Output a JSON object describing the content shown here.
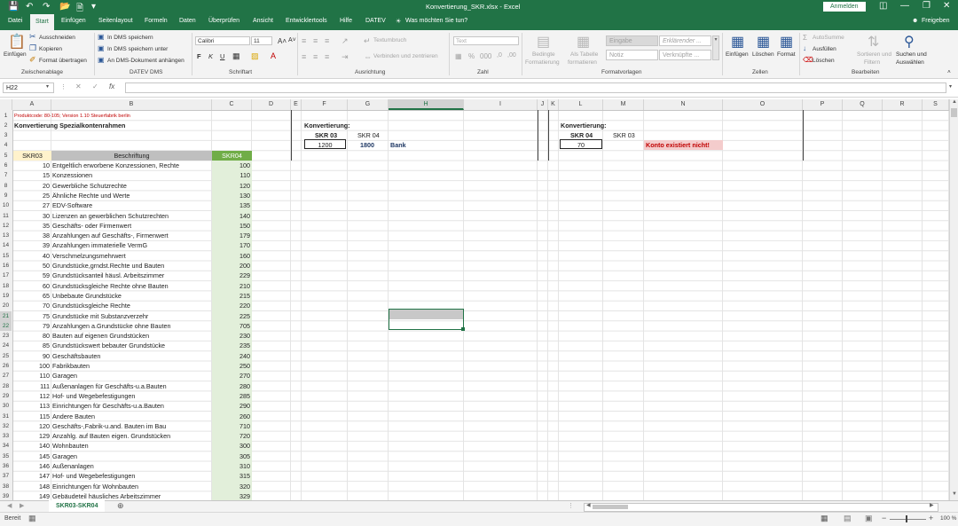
{
  "title": "Konvertierung_SKR.xlsx  -  Excel",
  "signin": "Anmelden",
  "share": "Freigeben",
  "tabs": [
    "Datei",
    "Start",
    "Einfügen",
    "Seitenlayout",
    "Formeln",
    "Daten",
    "Überprüfen",
    "Ansicht",
    "Entwicklertools",
    "Hilfe",
    "DATEV"
  ],
  "tell_me": "Was möchten Sie tun?",
  "ribbon": {
    "paste": "Einfügen",
    "cut": "Ausschneiden",
    "copy": "Kopieren",
    "format_painter": "Format übertragen",
    "grp_clipboard": "Zwischenablage",
    "dms1": "In DMS speichern",
    "dms2": "In DMS speichern unter",
    "dms3": "An DMS-Dokument anhängen",
    "grp_dms": "DATEV DMS",
    "font_name": "Calibri",
    "font_size": "11",
    "grp_font": "Schriftart",
    "wrap": "Textumbruch",
    "merge": "Verbinden und zentrieren",
    "grp_align": "Ausrichtung",
    "numfmt": "Text",
    "grp_number": "Zahl",
    "cond_fmt_1": "Bedingte",
    "cond_fmt_2": "Formatierung",
    "as_table_1": "Als Tabelle",
    "as_table_2": "formatieren",
    "style_eingabe": "Eingabe",
    "style_erkl": "Erklärender ...",
    "style_notiz": "Notiz",
    "style_verkn": "Verknüpfte ...",
    "grp_styles": "Formatvorlagen",
    "ins": "Einfügen",
    "del": "Löschen",
    "fmt": "Format",
    "grp_cells": "Zellen",
    "autosum": "AutoSumme",
    "fill": "Ausfüllen",
    "clear": "Löschen",
    "sort_1": "Sortieren und",
    "sort_2": "Filtern",
    "find_1": "Suchen und",
    "find_2": "Auswählen",
    "grp_edit": "Bearbeiten"
  },
  "namebox": "H22",
  "fx": "fx",
  "columns": [
    "A",
    "B",
    "C",
    "D",
    "E",
    "F",
    "G",
    "H",
    "I",
    "J",
    "K",
    "L",
    "M",
    "N",
    "O",
    "P",
    "Q",
    "R",
    "S"
  ],
  "rownums": [
    "1",
    "2",
    "3",
    "4",
    "5",
    "6",
    "7",
    "8",
    "9",
    "10",
    "11",
    "12",
    "13",
    "14",
    "15",
    "16",
    "17",
    "18",
    "19",
    "20",
    "21",
    "22",
    "23",
    "24",
    "25",
    "26",
    "27",
    "28",
    "29",
    "30",
    "31",
    "32",
    "33",
    "34",
    "35",
    "36",
    "37",
    "38",
    "39"
  ],
  "cells": {
    "a1": "Produktcode: 80-105; Version 1.10 Steuerfabrik berlin",
    "a2": "Konvertierung Spezialkontenrahmen",
    "hdr_a": "SKR03",
    "hdr_b": "Beschriftung",
    "hdr_c": "SKR04"
  },
  "conv1": {
    "title": "Konvertierung:",
    "from": "SKR 03",
    "to": "SKR 04",
    "input": "1200",
    "result": "1800",
    "name": "Bank"
  },
  "conv2": {
    "title": "Konvertierung:",
    "from": "SKR 04",
    "to": "SKR 03",
    "input": "70",
    "message": "Konto existiert nicht!"
  },
  "rows": [
    {
      "a": "10",
      "b": "Entgeltlich erworbene Konzessionen, Rechte",
      "c": "100"
    },
    {
      "a": "15",
      "b": "Konzessionen",
      "c": "110"
    },
    {
      "a": "20",
      "b": "Gewerbliche Schutzrechte",
      "c": "120"
    },
    {
      "a": "25",
      "b": "Ähnliche Rechte und Werte",
      "c": "130"
    },
    {
      "a": "27",
      "b": "EDV-Software",
      "c": "135"
    },
    {
      "a": "30",
      "b": "Lizenzen an gewerblichen Schutzrechten",
      "c": "140"
    },
    {
      "a": "35",
      "b": "Geschäfts- oder Firmenwert",
      "c": "150"
    },
    {
      "a": "38",
      "b": "Anzahlungen auf Geschäfts-, Firmenwert",
      "c": "179"
    },
    {
      "a": "39",
      "b": "Anzahlungen immaterielle VermG",
      "c": "170"
    },
    {
      "a": "40",
      "b": "Verschmelzungsmehrwert",
      "c": "160"
    },
    {
      "a": "50",
      "b": "Grundstücke,grndst.Rechte und Bauten",
      "c": "200"
    },
    {
      "a": "59",
      "b": "Grundstücksanteil häusl. Arbeitszimmer",
      "c": "229"
    },
    {
      "a": "60",
      "b": "Grundstücksgleiche Rechte ohne Bauten",
      "c": "210"
    },
    {
      "a": "65",
      "b": "Unbebaute Grundstücke",
      "c": "215"
    },
    {
      "a": "70",
      "b": "Grundstücksgleiche Rechte",
      "c": "220"
    },
    {
      "a": "75",
      "b": "Grundstücke mit Substanzverzehr",
      "c": "225"
    },
    {
      "a": "79",
      "b": "Anzahlungen a.Grundstücke ohne Bauten",
      "c": "705"
    },
    {
      "a": "80",
      "b": "Bauten auf eigenen Grundstücken",
      "c": "230"
    },
    {
      "a": "85",
      "b": "Grundstückswert bebauter Grundstücke",
      "c": "235"
    },
    {
      "a": "90",
      "b": "Geschäftsbauten",
      "c": "240"
    },
    {
      "a": "100",
      "b": "Fabrikbauten",
      "c": "250"
    },
    {
      "a": "110",
      "b": "Garagen",
      "c": "270"
    },
    {
      "a": "111",
      "b": "Außenanlagen für Geschäfts-u.a.Bauten",
      "c": "280"
    },
    {
      "a": "112",
      "b": "Hof- und Wegebefestigungen",
      "c": "285"
    },
    {
      "a": "113",
      "b": "Einrichtungen für Geschäfts-u.a.Bauten",
      "c": "290"
    },
    {
      "a": "115",
      "b": "Andere Bauten",
      "c": "260"
    },
    {
      "a": "120",
      "b": "Geschäfts-,Fabrik-u.and. Bauten im Bau",
      "c": "710"
    },
    {
      "a": "129",
      "b": "Anzahlg. auf Bauten eigen. Grundstücken",
      "c": "720"
    },
    {
      "a": "140",
      "b": "Wohnbauten",
      "c": "300"
    },
    {
      "a": "145",
      "b": "Garagen",
      "c": "305"
    },
    {
      "a": "146",
      "b": "Außenanlagen",
      "c": "310"
    },
    {
      "a": "147",
      "b": "Hof- und Wegebefestigungen",
      "c": "315"
    },
    {
      "a": "148",
      "b": "Einrichtungen für Wohnbauten",
      "c": "320"
    },
    {
      "a": "149",
      "b": "Gebäudeteil häusliches Arbeitszimmer",
      "c": "329"
    }
  ],
  "sheet_tab": "SKR03-SKR04",
  "status": "Bereit",
  "zoom": "100 %",
  "colors": {
    "excel_green": "#217346",
    "header_yellow": "#fff2cc",
    "header_gray": "#bfbfbf",
    "header_green": "#70ad47",
    "col_c_fill": "#e2efda",
    "warn_fill": "#f4cccc",
    "warn_text": "#c00000",
    "blue_text": "#1f3864"
  }
}
